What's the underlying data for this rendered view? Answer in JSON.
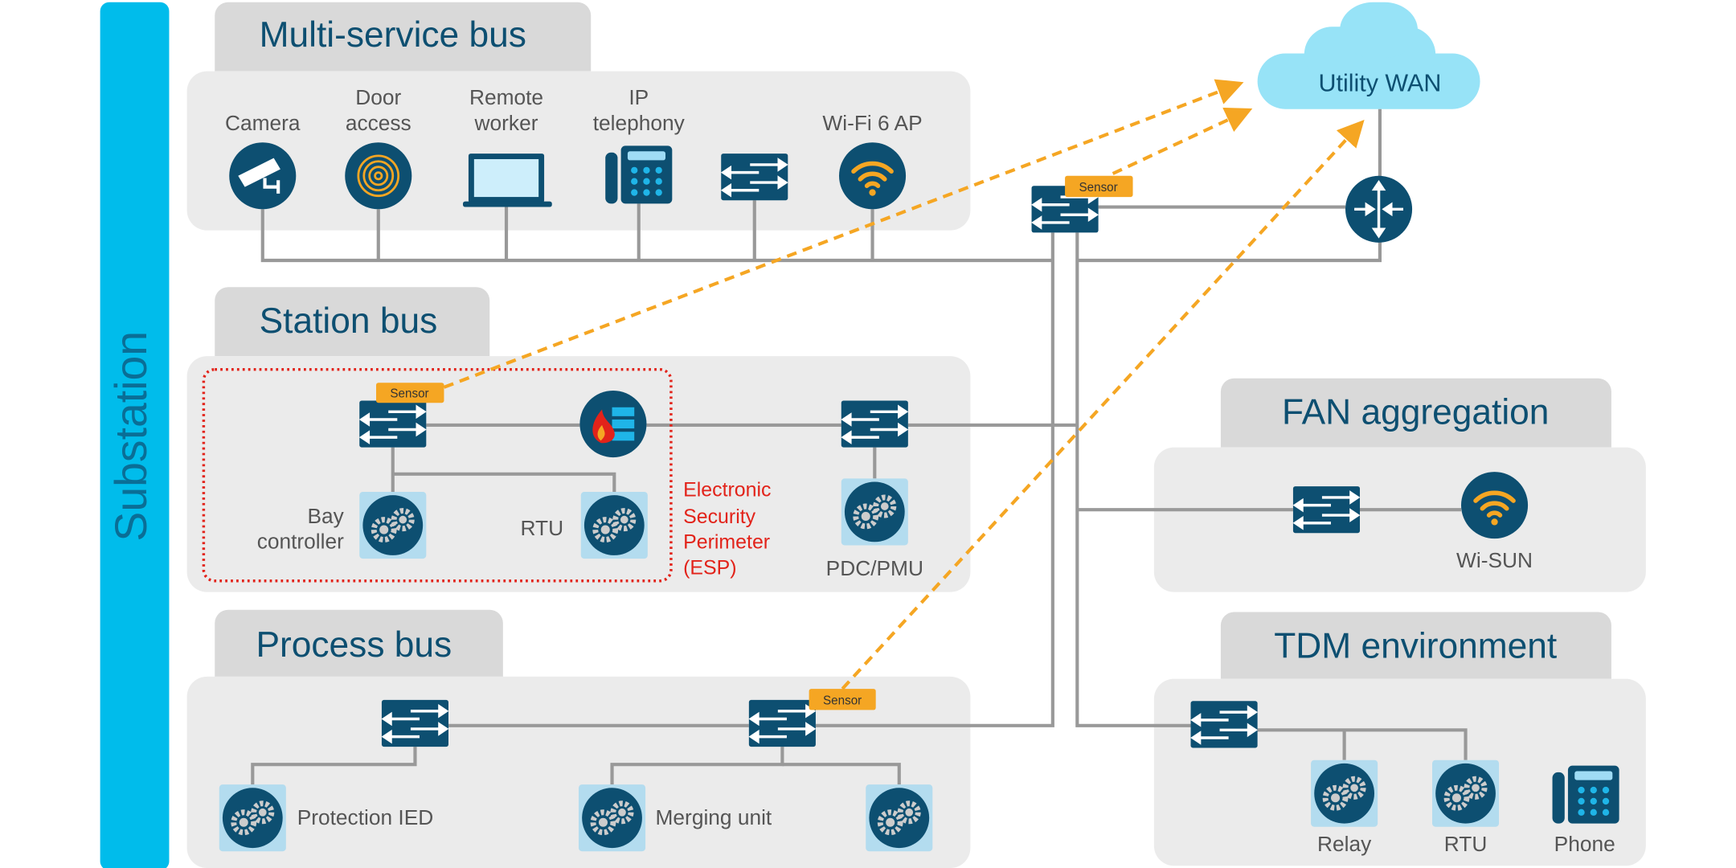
{
  "colors": {
    "accent": "#00bceb",
    "icon": "#0d4f71",
    "sensor": "#f5a623",
    "esp": "#e2231a",
    "cloud": "#97e3f7",
    "panel": "#ebebeb",
    "tab": "#d9d9d9"
  },
  "side_label": "Substation",
  "multi_service": {
    "title": "Multi-service bus",
    "devices": [
      {
        "line1": "",
        "line2": "Camera",
        "icon": "camera-icon"
      },
      {
        "line1": "Door",
        "line2": "access",
        "icon": "fingerprint-icon"
      },
      {
        "line1": "Remote",
        "line2": "worker",
        "icon": "laptop-icon"
      },
      {
        "line1": "IP",
        "line2": "telephony",
        "icon": "ip-phone-icon"
      },
      {
        "line1": "",
        "line2": "",
        "icon": "switch-icon"
      },
      {
        "line1": "",
        "line2": "Wi-Fi 6 AP",
        "icon": "wifi-icon"
      }
    ]
  },
  "wan": {
    "label": "Utility WAN",
    "sensor": "Sensor"
  },
  "station": {
    "title": "Station bus",
    "sensor": "Sensor",
    "bay_line1": "Bay",
    "bay_line2": "controller",
    "rtu": "RTU",
    "pdc": "PDC/PMU",
    "esp": [
      "Electronic",
      "Security",
      "Perimeter",
      "(ESP)"
    ]
  },
  "process": {
    "title": "Process bus",
    "sensor": "Sensor",
    "protection": "Protection IED",
    "merging": "Merging unit"
  },
  "fan": {
    "title": "FAN aggregation",
    "wisun": "Wi-SUN"
  },
  "tdm": {
    "title": "TDM environment",
    "relay": "Relay",
    "rtu": "RTU",
    "phone": "Phone"
  }
}
